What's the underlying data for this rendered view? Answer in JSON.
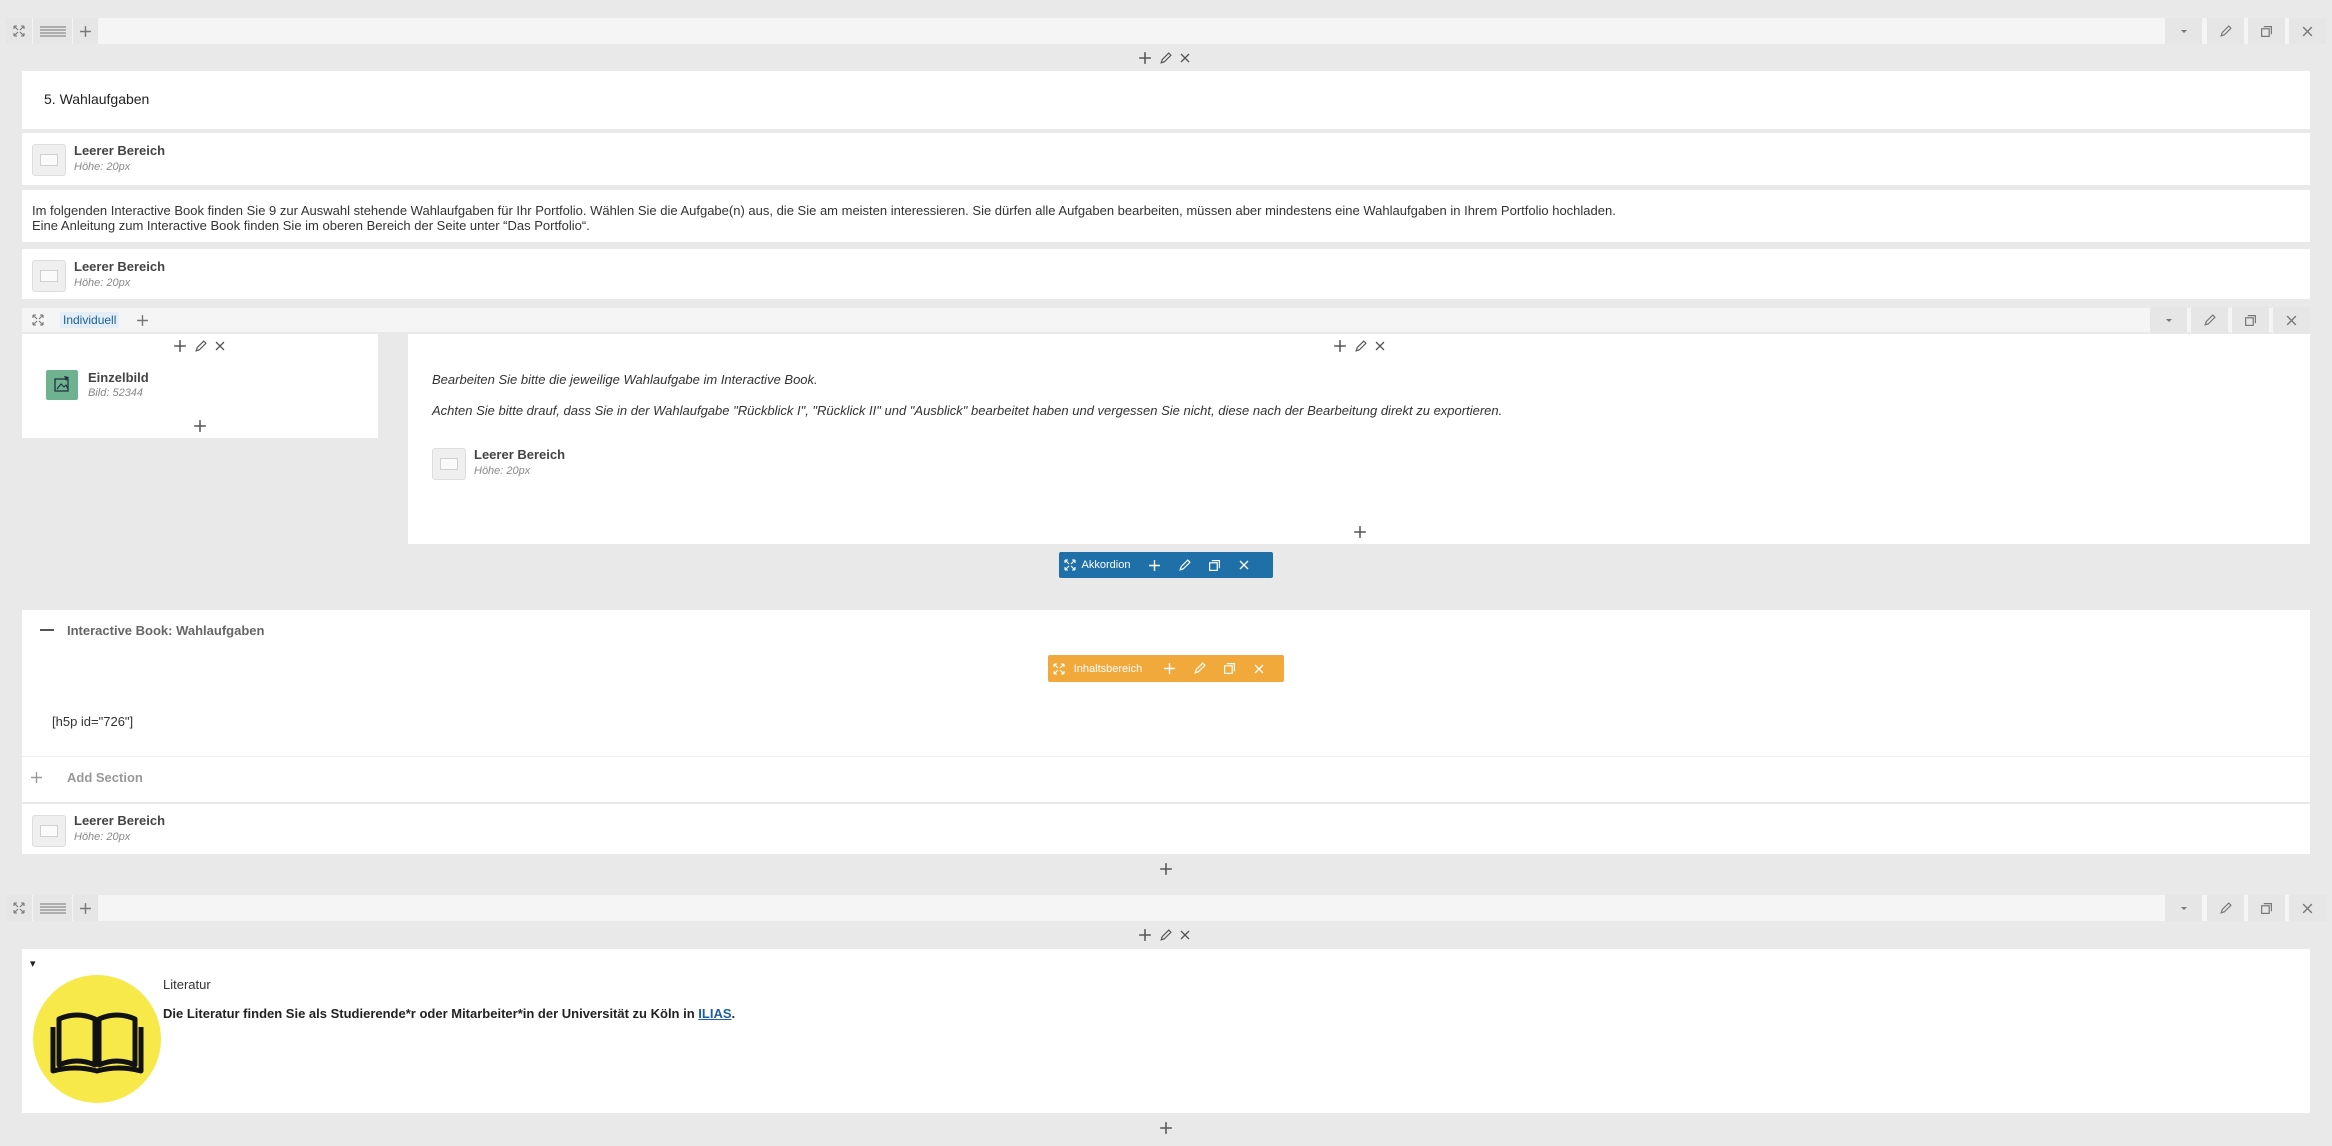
{
  "row1": {
    "section_title": "5. Wahlaufgaben",
    "placeholder1": {
      "title": "Leerer Bereich",
      "sub": "Höhe: 20px"
    },
    "text_line1": "Im folgenden Interactive Book finden Sie 9 zur Auswahl stehende Wahlaufgaben für Ihr Portfolio. Wählen Sie die Aufgabe(n) aus, die Sie am meisten interessieren. Sie dürfen alle Aufgaben bearbeiten, müssen aber mindestens eine Wahlaufgaben in Ihrem Portfolio hochladen.",
    "text_line2": "Eine Anleitung zum Interactive Book finden Sie im oberen Bereich der Seite unter “Das Portfolio“.",
    "placeholder2": {
      "title": "Leerer Bereich",
      "sub": "Höhe: 20px"
    },
    "inner_row_label": "Individuell",
    "image_module": {
      "title": "Einzelbild",
      "sub": "Bild: 52344"
    },
    "text_italic1": "Bearbeiten Sie bitte die jeweilige Wahlaufgabe im Interactive Book.",
    "text_italic2": "Achten Sie bitte drauf, dass Sie in der Wahlaufgabe \"Rückblick I\", \"Rücklick II\" und \"Ausblick\" bearbeitet haben und vergessen Sie nicht, diese nach der Bearbeitung direkt zu exportieren.",
    "placeholder3": {
      "title": "Leerer Bereich",
      "sub": "Höhe: 20px"
    },
    "accordion_label": "Akkordion",
    "accordion_header": "Interactive Book: Wahlaufgaben",
    "content_area_label": "Inhaltsbereich",
    "shortcode": "[h5p id=\"726\"]",
    "add_section": "Add Section",
    "placeholder4": {
      "title": "Leerer Bereich",
      "sub": "Höhe: 20px"
    }
  },
  "row2": {
    "toggle_marker": "▾",
    "lit_title": "Literatur",
    "lit_text_prefix": "Die Literatur finden Sie als Studierende*r oder Mitarbeiter*in der Universität zu Köln in ",
    "lit_link": "ILIAS",
    "lit_text_suffix": "."
  },
  "colors": {
    "accordion_blue": "#1f6fa8",
    "content_orange": "#f2a93b",
    "book_yellow": "#f7e94a",
    "link_blue": "#1f5fa0"
  },
  "icons": [
    "expand-icon",
    "drag-handle-icon",
    "plus-icon",
    "chevron-down-icon",
    "pencil-icon",
    "duplicate-icon",
    "close-icon",
    "image-icon",
    "book-icon"
  ]
}
